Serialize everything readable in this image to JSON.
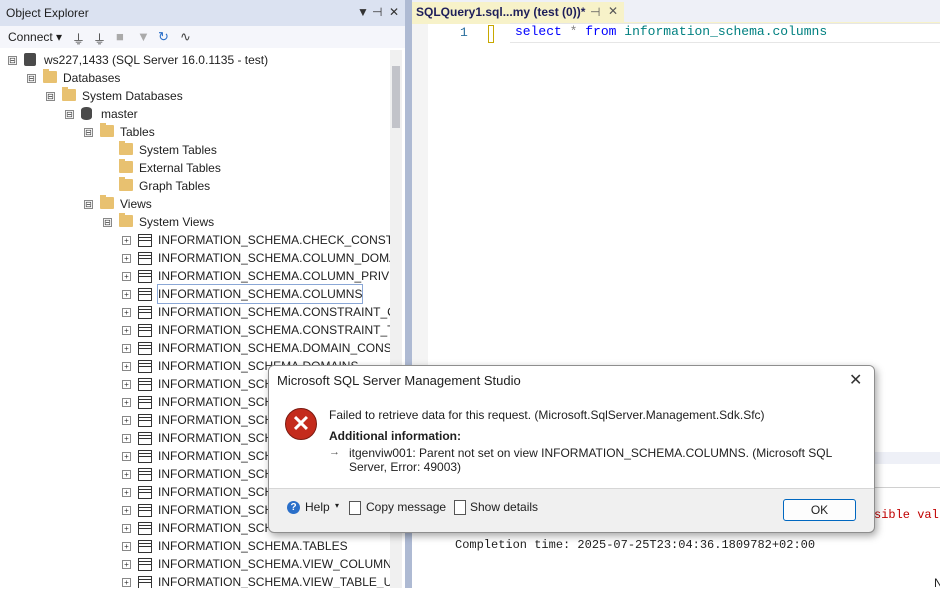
{
  "object_explorer": {
    "title": "Object Explorer",
    "title_controls": [
      "▼",
      "⊣",
      "✕"
    ],
    "connect_label": "Connect",
    "connect_arrow": "▾"
  },
  "tree": [
    {
      "label": "ws227,1433 (SQL Server 16.0.1135 - test)",
      "icon": "server-icon",
      "expander": "⊟"
    },
    {
      "label": "Databases",
      "icon": "folder-icon",
      "expander": "⊟"
    },
    {
      "label": "System Databases",
      "icon": "folder-icon",
      "expander": "⊟"
    },
    {
      "label": "master",
      "icon": "database-icon",
      "expander": "⊟"
    },
    {
      "label": "Tables",
      "icon": "folder-icon",
      "expander": "⊟"
    },
    {
      "label": "System Tables",
      "icon": "folder-icon",
      "expander": ""
    },
    {
      "label": "External Tables",
      "icon": "folder-icon",
      "expander": ""
    },
    {
      "label": "Graph Tables",
      "icon": "folder-icon",
      "expander": ""
    },
    {
      "label": "Views",
      "icon": "folder-icon",
      "expander": "⊟"
    },
    {
      "label": "System Views",
      "icon": "folder-icon",
      "expander": "⊟"
    },
    {
      "label": "INFORMATION_SCHEMA.CHECK_CONSTRA",
      "icon": "view-icon",
      "expander": "+"
    },
    {
      "label": "INFORMATION_SCHEMA.COLUMN_DOMA",
      "icon": "view-icon",
      "expander": "+"
    },
    {
      "label": "INFORMATION_SCHEMA.COLUMN_PRIVILE",
      "icon": "view-icon",
      "expander": "+"
    },
    {
      "label": "INFORMATION_SCHEMA.COLUMNS",
      "icon": "view-icon",
      "expander": "+"
    },
    {
      "label": "INFORMATION_SCHEMA.CONSTRAINT_CO",
      "icon": "view-icon",
      "expander": "+"
    },
    {
      "label": "INFORMATION_SCHEMA.CONSTRAINT_TA",
      "icon": "view-icon",
      "expander": "+"
    },
    {
      "label": "INFORMATION_SCHEMA.DOMAIN_CONST",
      "icon": "view-icon",
      "expander": "+"
    },
    {
      "label": "INFORMATION_SCHEMA.DOMAINS",
      "icon": "view-icon",
      "expander": "+"
    },
    {
      "label": "INFORMATION_SCH",
      "icon": "view-icon",
      "expander": "+"
    },
    {
      "label": "INFORMATION_SCH",
      "icon": "view-icon",
      "expander": "+"
    },
    {
      "label": "INFORMATION_SCH",
      "icon": "view-icon",
      "expander": "+"
    },
    {
      "label": "INFORMATION_SCH",
      "icon": "view-icon",
      "expander": "+"
    },
    {
      "label": "INFORMATION_SCH",
      "icon": "view-icon",
      "expander": "+"
    },
    {
      "label": "INFORMATION_SCH",
      "icon": "view-icon",
      "expander": "+"
    },
    {
      "label": "INFORMATION_SCH",
      "icon": "view-icon",
      "expander": "+"
    },
    {
      "label": "INFORMATION_SCH",
      "icon": "view-icon",
      "expander": "+"
    },
    {
      "label": "INFORMATION_SCH",
      "icon": "view-icon",
      "expander": "+"
    },
    {
      "label": "INFORMATION_SCHEMA.TABLES",
      "icon": "view-icon",
      "expander": "+"
    },
    {
      "label": "INFORMATION_SCHEMA.VIEW_COLUMN_U",
      "icon": "view-icon",
      "expander": "+"
    },
    {
      "label": "INFORMATION_SCHEMA.VIEW_TABLE_USA",
      "icon": "view-icon",
      "expander": "+"
    }
  ],
  "editor": {
    "tab_label": "SQLQuery1.sql...my (test (0))*",
    "tab_pin": "⊣",
    "tab_close": "✕",
    "line_number": "1",
    "code": {
      "kw1": "select",
      "op": "*",
      "kw2": "from",
      "ident": "information_schema.columns"
    }
  },
  "results": {
    "partial_message": "sible val",
    "completion": "Completion time: 2025-07-25T23:04:36.1809782+02:00",
    "corner": "N"
  },
  "dialog": {
    "title": "Microsoft SQL Server Management Studio",
    "close": "✕",
    "error_glyph": "✕",
    "message": "Failed to retrieve data for this request. (Microsoft.SqlServer.Management.Sdk.Sfc)",
    "additional_info_label": "Additional information:",
    "arrow": "→",
    "detail": "itgenviw001: Parent not set on view INFORMATION_SCHEMA.COLUMNS. (Microsoft SQL Server, Error: 49003)",
    "help_label": "Help",
    "help_glyph": "?",
    "help_arrow": "▾",
    "copy_label": "Copy message",
    "details_label": "Show details",
    "ok_label": "OK"
  },
  "colors": {
    "panel_title": "#dbe2f1",
    "tab_active": "#f7f2c9",
    "keyword": "#0000ff",
    "identifier": "#008080",
    "error_red": "#c42b1c",
    "ok_border": "#0067c0"
  }
}
